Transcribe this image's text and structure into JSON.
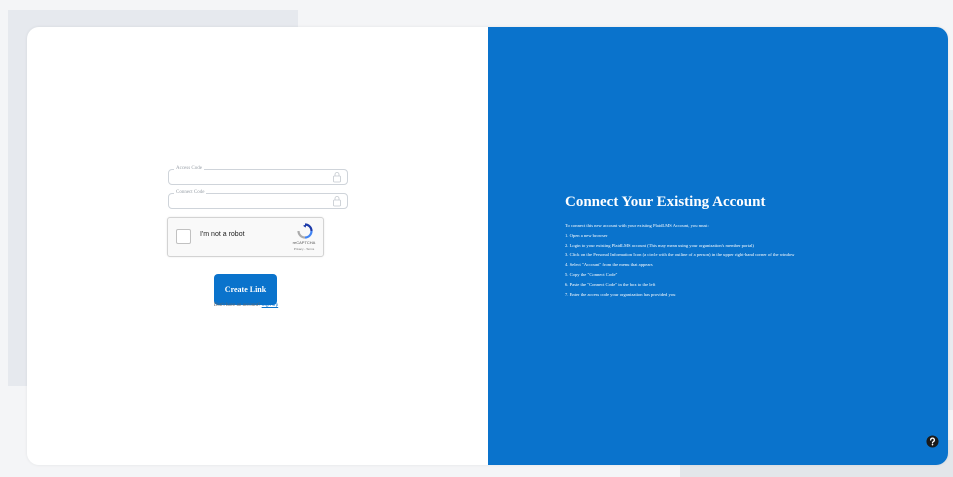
{
  "form": {
    "access_code_label": "Access Code",
    "connect_code_label": "Connect Code",
    "lock_icon": "lock-icon",
    "captcha": {
      "label": "I'm not a robot",
      "brand": "reCAPTCHA",
      "links": "Privacy - Terms"
    },
    "create_button_label": "Create Link",
    "signup_prompt": "Don't have an account?",
    "signup_link": "Sign Up"
  },
  "info": {
    "title": "Connect Your Existing Account",
    "intro": "To connect this new account with your existing PlaidLMS Account, you must:",
    "steps": [
      "1. Open a new browser",
      "2. Login to your existing PlaidLMS account (This may mean using your organization's member portal)",
      "3. Click on the Personal Information Icon (a circle with the outline of a person) in the upper right-hand corner of the window",
      "4. Select \"Account\" from the menu that appears",
      "5. Copy the \"Connect Code\"",
      "6. Paste the \"Connect Code\" in the box to the left",
      "7. Enter the access code your organization has provided you"
    ],
    "help_icon": "help-icon"
  },
  "colors": {
    "accent": "#0a73cc",
    "background": "#f4f5f7"
  }
}
